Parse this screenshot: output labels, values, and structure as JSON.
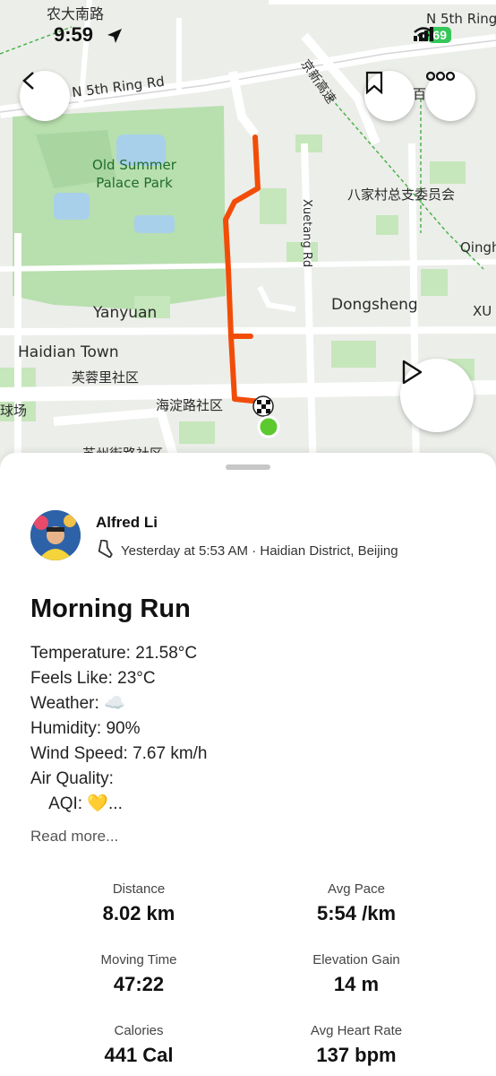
{
  "status_bar": {
    "time": "9:59",
    "battery": "69"
  },
  "map": {
    "labels": {
      "top_left": "农大南路",
      "north_ring_right": "N 5th Ring",
      "north_ring": "N 5th Ring Rd",
      "expressway": "京新高速",
      "park": "Old Summer Palace Park",
      "baijiacun": "八家村总支委员会",
      "xuetang": "Xuetang Rd",
      "qingh": "Qingh",
      "yanyuan": "Yanyuan",
      "dongsheng": "Dongsheng",
      "xu": "XU",
      "haidian_town": "Haidian Town",
      "furongli": "芙蓉里社区",
      "haidianlu": "海淀路社区",
      "qiuchang": "球场",
      "suzhoujie": "苏州街路社区",
      "bai": "百"
    }
  },
  "activity": {
    "athlete": "Alfred Li",
    "meta": "Yesterday at 5:53 AM · Haidian District, Beijing",
    "title": "Morning Run",
    "description": [
      "Temperature: 21.58°C",
      "Feels Like: 23°C",
      "Weather: ☁️",
      "Humidity: 90%",
      "Wind Speed: 7.67 km/h",
      "Air Quality:",
      "    AQI: 💛..."
    ],
    "read_more": "Read more...",
    "stats": [
      {
        "label": "Distance",
        "value": "8.02 km"
      },
      {
        "label": "Avg Pace",
        "value": "5:54 /km"
      },
      {
        "label": "Moving Time",
        "value": "47:22"
      },
      {
        "label": "Elevation Gain",
        "value": "14 m"
      },
      {
        "label": "Calories",
        "value": "441 Cal"
      },
      {
        "label": "Avg Heart Rate",
        "value": "137 bpm"
      }
    ]
  },
  "colors": {
    "route": "#f24d08",
    "start_marker": "#5cc92f",
    "park_green": "#b8dfae",
    "water": "#a8d0ea"
  }
}
